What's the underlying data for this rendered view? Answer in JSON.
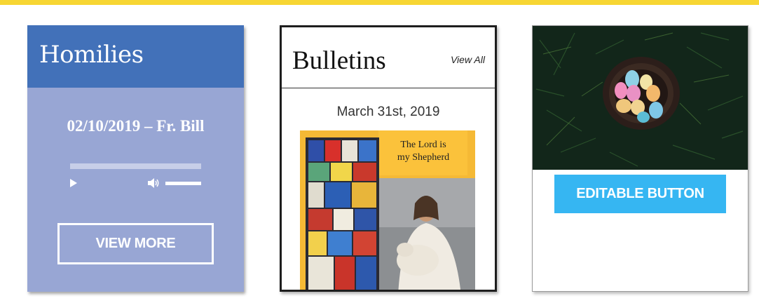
{
  "colors": {
    "top_bar": "#f7d633",
    "homilies_header": "#4271b9",
    "homilies_body": "#98a6d4",
    "editable_button": "#36b6f2"
  },
  "homilies": {
    "title": "Homilies",
    "latest": "02/10/2019 – Fr. Bill",
    "player": {
      "play_icon": "play-icon",
      "volume_icon": "volume-icon",
      "progress": 0.0,
      "volume": 1.0
    },
    "view_more_label": "VIEW MORE"
  },
  "bulletins": {
    "title": "Bulletins",
    "view_all_label": "View All",
    "date": "March 31st, 2019",
    "cover_text_line1": "The Lord is",
    "cover_text_line2": "my Shepherd"
  },
  "editable": {
    "image_description": "easter-eggs-in-nest",
    "button_label": "EDITABLE BUTTON"
  }
}
